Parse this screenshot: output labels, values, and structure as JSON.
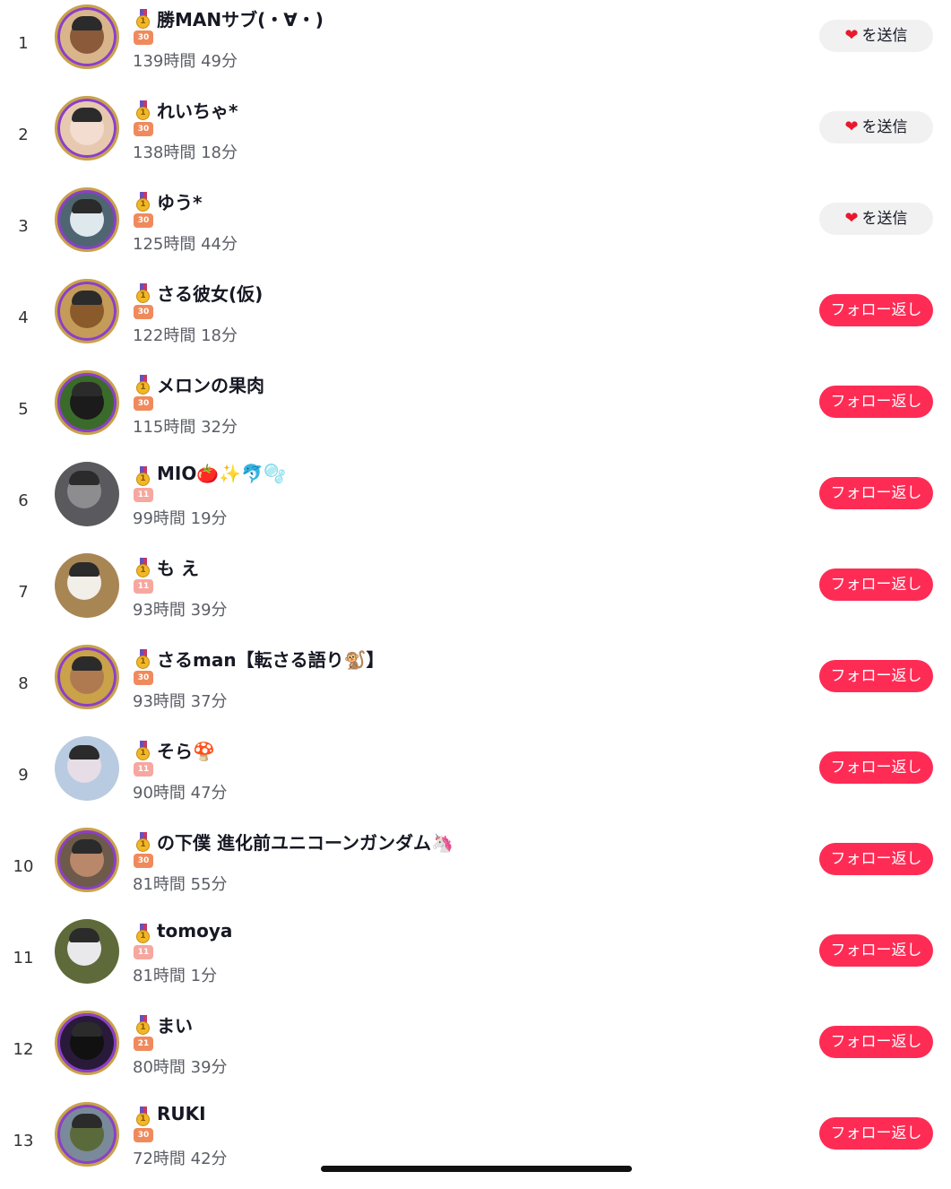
{
  "rows": [
    {
      "rank": "1",
      "name": "勝MANサブ(・∀・)",
      "badge": "30",
      "time": "139時間 49分",
      "action": "を送信",
      "action_type": "send",
      "avatar_bg": "#d9b58c",
      "face": "#8a5a3a"
    },
    {
      "rank": "2",
      "name": "れいちゃ*",
      "badge": "30",
      "time": "138時間 18分",
      "action": "を送信",
      "action_type": "send",
      "avatar_bg": "#e7c9b0",
      "face": "#f3ddd0"
    },
    {
      "rank": "3",
      "name": "ゆう*",
      "badge": "30",
      "time": "125時間 44分",
      "action": "を送信",
      "action_type": "send",
      "avatar_bg": "#4f6672",
      "face": "#dfe8ec"
    },
    {
      "rank": "4",
      "name": "さる彼女(仮)",
      "badge": "30",
      "time": "122時間 18分",
      "action": "フォロー返し",
      "action_type": "follow",
      "avatar_bg": "#c59b5a",
      "face": "#8b5a2b"
    },
    {
      "rank": "5",
      "name": "メロンの果肉",
      "badge": "30",
      "time": "115時間 32分",
      "action": "フォロー返し",
      "action_type": "follow",
      "avatar_bg": "#3b6b2a",
      "face": "#1b1b1b"
    },
    {
      "rank": "6",
      "name": "MIO🍅✨🐬🫧",
      "badge": "11",
      "time": "99時間 19分",
      "action": "フォロー返し",
      "action_type": "follow",
      "avatar_bg": "#5a5a5e",
      "face": "#8d8d90"
    },
    {
      "rank": "7",
      "name": "も え",
      "badge": "11",
      "time": "93時間 39分",
      "action": "フォロー返し",
      "action_type": "follow",
      "avatar_bg": "#a88654",
      "face": "#f2eee8"
    },
    {
      "rank": "8",
      "name": "さるman【転さる語り🐒】",
      "badge": "30",
      "time": "93時間 37分",
      "action": "フォロー返し",
      "action_type": "follow",
      "avatar_bg": "#c9a24a",
      "face": "#b07a50"
    },
    {
      "rank": "9",
      "name": "そら🍄",
      "badge": "11",
      "time": "90時間 47分",
      "action": "フォロー返し",
      "action_type": "follow",
      "avatar_bg": "#b9cbe0",
      "face": "#e6dde6"
    },
    {
      "rank": "10",
      "name": "の下僕 進化前ユニコーンガンダム🦄",
      "badge": "30",
      "time": "81時間 55分",
      "action": "フォロー返し",
      "action_type": "follow",
      "avatar_bg": "#6d5a4a",
      "face": "#b9876a"
    },
    {
      "rank": "11",
      "name": "tomoya",
      "badge": "11",
      "time": "81時間 1分",
      "action": "フォロー返し",
      "action_type": "follow",
      "avatar_bg": "#5e6a3a",
      "face": "#e9e9ec"
    },
    {
      "rank": "12",
      "name": "まい",
      "badge": "21",
      "time": "80時間 39分",
      "action": "フォロー返し",
      "action_type": "follow",
      "avatar_bg": "#2a1a3a",
      "face": "#111111"
    },
    {
      "rank": "13",
      "name": "RUKI",
      "badge": "30",
      "time": "72時間 42分",
      "action": "フォロー返し",
      "action_type": "follow",
      "avatar_bg": "#7a8a9a",
      "face": "#5a6a3a"
    }
  ],
  "icons": {
    "heart": "heart-icon",
    "medal": "medal-icon",
    "badge": "level-badge"
  },
  "colors": {
    "follow_button": "#fe2c55",
    "send_button": "#f1f1f2",
    "heart": "#e8192c",
    "secondary_text": "#5c5e66"
  }
}
